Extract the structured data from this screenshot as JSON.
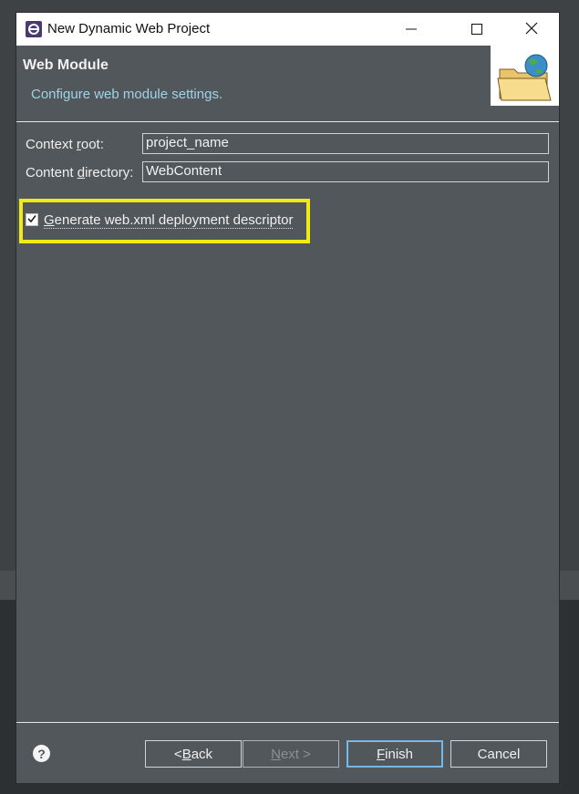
{
  "window": {
    "title": "New Dynamic Web Project"
  },
  "header": {
    "title": "Web Module",
    "description": "Configure web module settings."
  },
  "fields": {
    "context_root": {
      "label_pre": "Context ",
      "label_mnemonic": "r",
      "label_post": "oot:",
      "value": "project_name"
    },
    "content_directory": {
      "label_pre": "Content ",
      "label_mnemonic": "d",
      "label_post": "irectory:",
      "value": "WebContent"
    }
  },
  "generate_descriptor": {
    "checked": true,
    "label_mnemonic": "G",
    "label_post": "enerate web.xml deployment descriptor",
    "highlight_color": "#f2ea13"
  },
  "buttons": {
    "back": {
      "pre": "< ",
      "mnemonic": "B",
      "post": "ack"
    },
    "next": {
      "mnemonic": "N",
      "post": "ext >"
    },
    "finish": {
      "mnemonic": "F",
      "post": "inish"
    },
    "cancel": "Cancel",
    "help": "?"
  },
  "colors": {
    "dialog_bg": "#51575b",
    "description_text": "#9fd3e6",
    "default_button_border": "#6fb3e5"
  },
  "icons": [
    "eclipse-app-icon",
    "minimize-icon",
    "maximize-icon",
    "close-icon",
    "web-folder-globe-icon",
    "checkmark-icon",
    "help-icon"
  ]
}
